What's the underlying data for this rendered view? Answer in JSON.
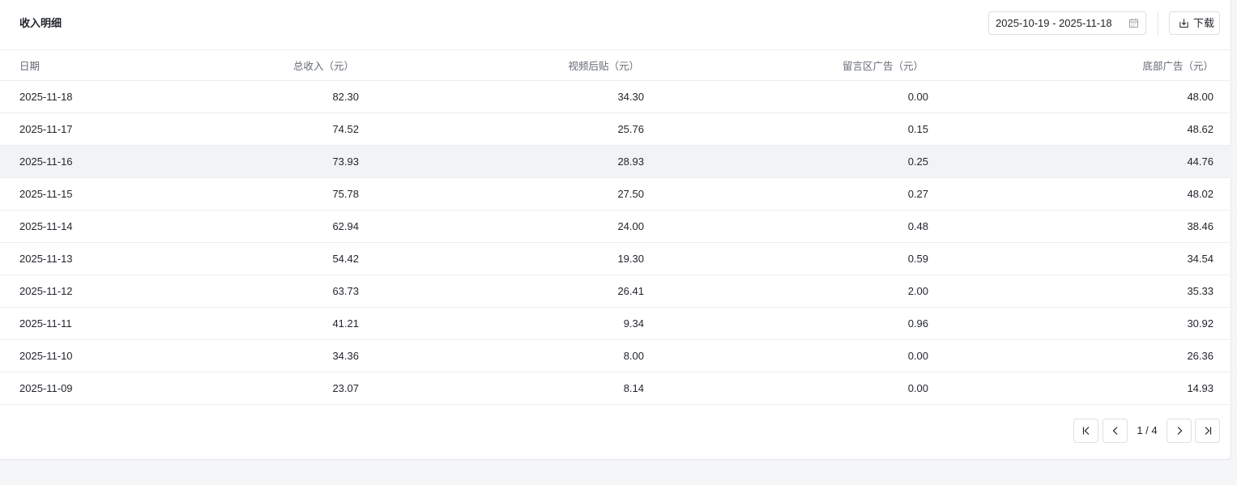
{
  "header": {
    "title": "收入明细",
    "date_range": "2025-10-19 - 2025-11-18",
    "download_label": "下载"
  },
  "table": {
    "columns": [
      "日期",
      "总收入（元）",
      "视频后贴（元）",
      "留言区广告（元）",
      "底部广告（元）"
    ],
    "rows": [
      [
        "2025-11-18",
        "82.30",
        "34.30",
        "0.00",
        "48.00"
      ],
      [
        "2025-11-17",
        "74.52",
        "25.76",
        "0.15",
        "48.62"
      ],
      [
        "2025-11-16",
        "73.93",
        "28.93",
        "0.25",
        "44.76"
      ],
      [
        "2025-11-15",
        "75.78",
        "27.50",
        "0.27",
        "48.02"
      ],
      [
        "2025-11-14",
        "62.94",
        "24.00",
        "0.48",
        "38.46"
      ],
      [
        "2025-11-13",
        "54.42",
        "19.30",
        "0.59",
        "34.54"
      ],
      [
        "2025-11-12",
        "63.73",
        "26.41",
        "2.00",
        "35.33"
      ],
      [
        "2025-11-11",
        "41.21",
        "9.34",
        "0.96",
        "30.92"
      ],
      [
        "2025-11-10",
        "34.36",
        "8.00",
        "0.00",
        "26.36"
      ],
      [
        "2025-11-09",
        "23.07",
        "8.14",
        "0.00",
        "14.93"
      ]
    ],
    "highlighted_row": 2
  },
  "pagination": {
    "page_text": "1 / 4",
    "icons": [
      "first-page-icon",
      "prev-page-icon",
      "next-page-icon",
      "last-page-icon"
    ]
  },
  "colors": {
    "background": "#f5f6f7",
    "card": "#ffffff",
    "border": "#eceef1",
    "row_highlight": "#f2f3f5",
    "header_text": "#646a73",
    "text": "#1f2329"
  }
}
